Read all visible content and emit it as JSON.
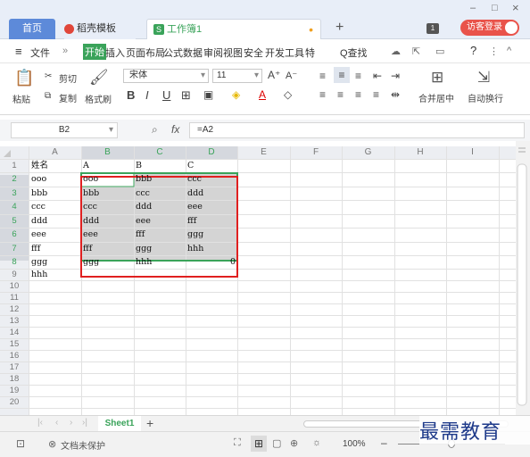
{
  "tabs": {
    "home": "首页",
    "daoke": "稻壳模板",
    "workbook": "工作簿1",
    "login": "访客登录",
    "dot": "•",
    "plus": "+"
  },
  "window": {
    "minimize": "–",
    "maximize": "□",
    "close": "×"
  },
  "menu": {
    "file": "文件",
    "more": "»",
    "start": "开始",
    "insert": "插入",
    "layout": "页面布局",
    "formula": "公式",
    "data": "数据",
    "review": "审阅",
    "view": "视图",
    "security": "安全",
    "dev": "开发工具",
    "special": "特",
    "find": "Q查找",
    "help": "?"
  },
  "ribbon": {
    "cut": "剪切",
    "copy": "复制",
    "paste": "粘贴",
    "format_painter": "格式刷",
    "font_name": "宋体",
    "font_size": "11",
    "bold": "B",
    "italic": "I",
    "underline": "U",
    "grow_font": "A⁺",
    "shrink_font": "A⁻",
    "merge_center": "合并居中",
    "wrap_text": "自动换行"
  },
  "formula_bar": {
    "cell_ref": "B2",
    "fx": "fx",
    "formula": "=A2"
  },
  "columns": [
    "A",
    "B",
    "C",
    "D",
    "E",
    "F",
    "G",
    "H",
    "I"
  ],
  "rows": [
    "1",
    "2",
    "3",
    "4",
    "5",
    "6",
    "7",
    "8",
    "9",
    "10",
    "11",
    "12",
    "13",
    "14",
    "15",
    "16",
    "17",
    "18",
    "19",
    "20"
  ],
  "cells": {
    "A": [
      "姓名",
      "ooo",
      "bbb",
      "ccc",
      "ddd",
      "eee",
      "fff",
      "ggg",
      "hhh"
    ],
    "B": [
      "A",
      "ooo",
      "bbb",
      "ccc",
      "ddd",
      "eee",
      "fff",
      "ggg"
    ],
    "C": [
      "B",
      "bbb",
      "ccc",
      "ddd",
      "eee",
      "fff",
      "ggg",
      "hhh"
    ],
    "D": [
      "C",
      "ccc",
      "ddd",
      "eee",
      "fff",
      "ggg",
      "hhh",
      "0"
    ]
  },
  "sheet": {
    "name": "Sheet1",
    "add": "+"
  },
  "status": {
    "protect": "文档未保护",
    "zoom": "100%",
    "minus": "–"
  },
  "watermark": "最需教育"
}
